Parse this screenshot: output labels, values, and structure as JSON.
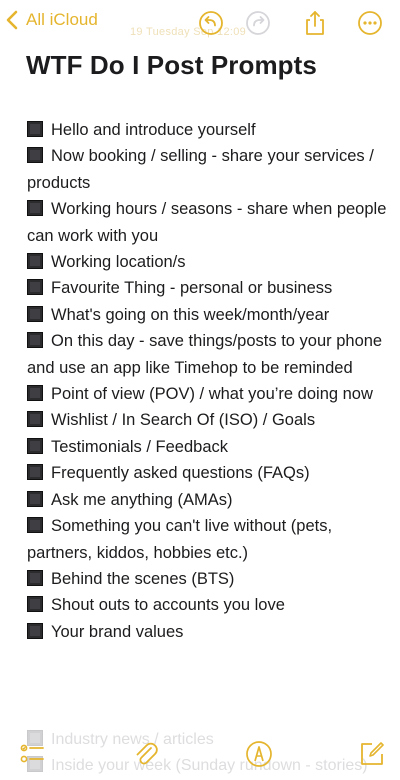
{
  "nav": {
    "back_label": "All iCloud",
    "ghost_text": "19 Tuesday Sep 12:09"
  },
  "toolbar": {
    "icons": [
      "undo-icon",
      "redo-icon",
      "share-icon",
      "more-icon"
    ]
  },
  "note": {
    "title": "WTF Do I Post Prompts",
    "items": [
      "Hello and introduce yourself",
      "Now booking / selling - share your services / products",
      "Working hours / seasons - share when people can work with you",
      "Working location/s",
      "Favourite Thing - personal or business",
      "What's going on this week/month/year",
      "On this day - save things/posts to your phone and use an app like Timehop to be reminded",
      "Point of view (POV) / what you’re doing now",
      "Wishlist / In Search Of (ISO) / Goals",
      "Testimonials / Feedback",
      "Frequently asked questions (FAQs)",
      "Ask me anything (AMAs)",
      "Something you can't live without (pets, partners, kiddos, hobbies etc.)",
      "Behind the scenes (BTS)",
      "Shout outs to accounts you love",
      "Your brand values"
    ],
    "faded_items": [
      "Industry news / articles",
      "Inside your week (Sunday rundown - stories)"
    ]
  },
  "bottom_toolbar": {
    "icons": [
      "checklist-icon",
      "paperclip-icon",
      "markup-pen-icon",
      "compose-icon"
    ]
  },
  "colors": {
    "accent": "#e5b52e",
    "text": "#1c1c1e",
    "background": "#ffffff"
  }
}
